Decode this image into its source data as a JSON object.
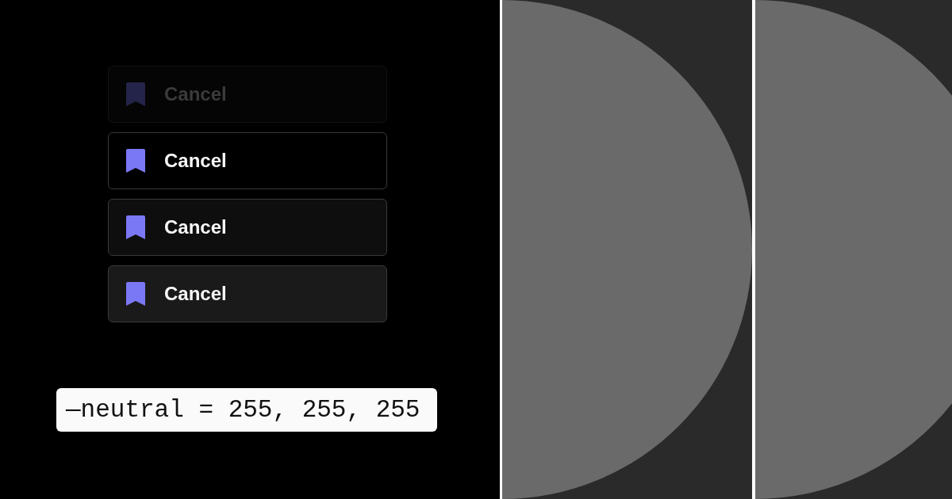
{
  "buttons": [
    {
      "label": "Cancel",
      "disabled": true,
      "kind": "default"
    },
    {
      "label": "Cancel",
      "disabled": false,
      "kind": "default"
    },
    {
      "label": "Cancel",
      "disabled": false,
      "kind": "hover"
    },
    {
      "label": "Cancel",
      "disabled": false,
      "kind": "pressed"
    }
  ],
  "token_label": {
    "text": "—neutral = 255, 255, 255"
  }
}
